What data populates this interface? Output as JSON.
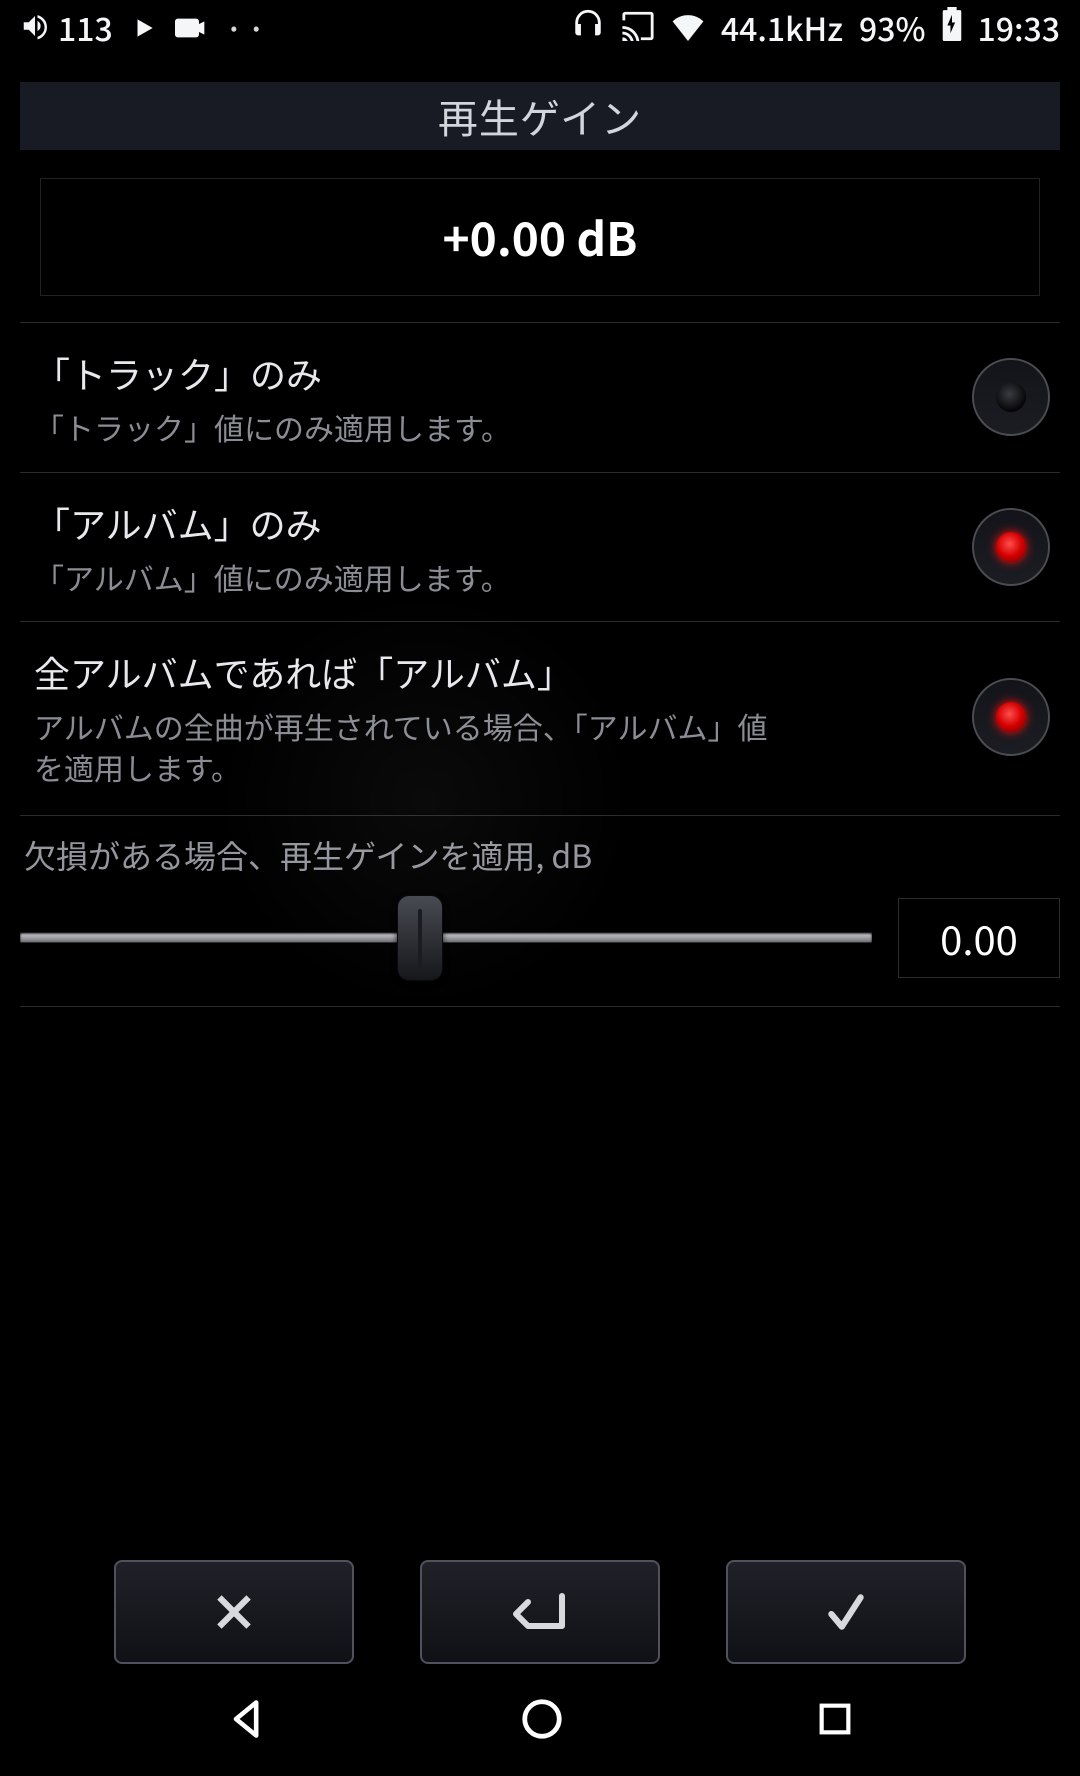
{
  "statusbar": {
    "volume": "113",
    "sample_rate": "44.1kHz",
    "battery": "93%",
    "time": "19:33"
  },
  "header": {
    "title": "再生ゲイン"
  },
  "gain_display": "+0.00 dB",
  "options": [
    {
      "title": "「トラック」のみ",
      "subtitle": "「トラック」値にのみ適用します。",
      "selected": false
    },
    {
      "title": "「アルバム」のみ",
      "subtitle": "「アルバム」値にのみ適用します。",
      "selected": true
    },
    {
      "title": "全アルバムであれば「アルバム」",
      "subtitle": "アルバムの全曲が再生されている場合、「アルバム」値を適用します。",
      "selected": true
    }
  ],
  "slider": {
    "label": "欠損がある場合、再生ゲインを適用, dB",
    "value_display": "0.00",
    "value": 0.0,
    "min": -15,
    "max": 15
  }
}
